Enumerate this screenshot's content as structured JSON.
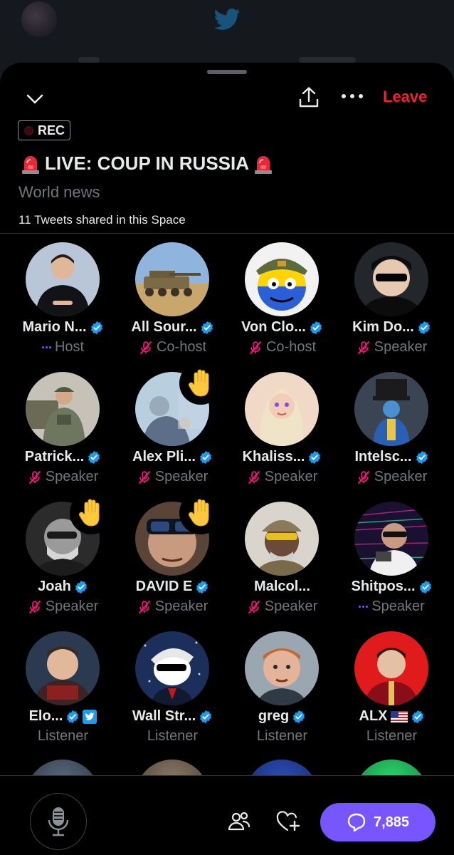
{
  "header": {
    "leave_label": "Leave",
    "rec_label": "REC",
    "title": "LIVE: COUP IN RUSSIA",
    "topic": "World news",
    "tweets_shared": "11 Tweets shared in this Space"
  },
  "icons": {
    "collapse": "chevron-down-icon",
    "share": "share-icon",
    "more": "more-icon",
    "siren": "siren-emoji",
    "verified": "verified-badge-icon",
    "mic_off": "mic-off-icon",
    "raised_hand": "raised-hand-icon",
    "microphone": "microphone-icon",
    "people": "people-icon",
    "heart_plus": "heart-plus-icon",
    "comment": "comment-icon"
  },
  "colors": {
    "accent": "#7856ff",
    "leave": "#f4212e",
    "verified": "#1d9bf0",
    "muted": "#71767b",
    "mic_off": "#f91880"
  },
  "participants": [
    {
      "name": "Mario N...",
      "role": "Host",
      "verified": true,
      "role_icon": "speaking",
      "hand": false,
      "avatar": "a1"
    },
    {
      "name": "All Sour...",
      "role": "Co-host",
      "verified": true,
      "role_icon": "muted",
      "hand": false,
      "avatar": "a2"
    },
    {
      "name": "Von Clo...",
      "role": "Co-host",
      "verified": true,
      "role_icon": "muted",
      "hand": false,
      "avatar": "a3"
    },
    {
      "name": "Kim Do...",
      "role": "Speaker",
      "verified": true,
      "role_icon": "muted",
      "hand": false,
      "avatar": "a4"
    },
    {
      "name": "Patrick...",
      "role": "Speaker",
      "verified": true,
      "role_icon": "muted",
      "hand": false,
      "avatar": "a5"
    },
    {
      "name": "Alex Pli...",
      "role": "Speaker",
      "verified": true,
      "role_icon": "muted",
      "hand": true,
      "avatar": "a6"
    },
    {
      "name": "Khaliss...",
      "role": "Speaker",
      "verified": true,
      "role_icon": "muted",
      "hand": false,
      "avatar": "a7"
    },
    {
      "name": "Intelsc...",
      "role": "Speaker",
      "verified": true,
      "role_icon": "muted",
      "hand": false,
      "avatar": "a8"
    },
    {
      "name": "Joah",
      "role": "Speaker",
      "verified": true,
      "role_icon": "muted",
      "hand": true,
      "avatar": "a9"
    },
    {
      "name": "DAVID E",
      "role": "Speaker",
      "verified": true,
      "role_icon": "muted",
      "hand": true,
      "avatar": "a10"
    },
    {
      "name": "Malcol...",
      "role": "Speaker",
      "verified": false,
      "role_icon": "muted",
      "hand": false,
      "avatar": "a11"
    },
    {
      "name": "Shitpos...",
      "role": "Speaker",
      "verified": true,
      "role_icon": "speaking",
      "hand": false,
      "avatar": "a12"
    },
    {
      "name": "Elo...",
      "role": "Listener",
      "verified": true,
      "extra_badge": "twitter",
      "role_icon": "none",
      "hand": false,
      "avatar": "a13"
    },
    {
      "name": "Wall Str...",
      "role": "Listener",
      "verified": true,
      "role_icon": "none",
      "hand": false,
      "avatar": "a14"
    },
    {
      "name": "greg",
      "role": "Listener",
      "verified": true,
      "role_icon": "none",
      "hand": false,
      "avatar": "a15"
    },
    {
      "name": "ALX",
      "role": "Listener",
      "verified": true,
      "flag": "us",
      "role_icon": "none",
      "hand": false,
      "avatar": "a16"
    }
  ],
  "footer": {
    "comment_count": "7,885"
  }
}
